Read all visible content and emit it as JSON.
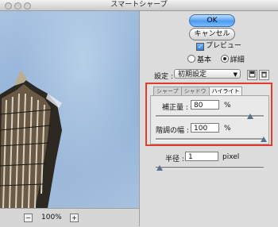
{
  "window": {
    "title": "スマートシャープ"
  },
  "preview": {
    "zoom": "100%",
    "zoom_out": "−",
    "zoom_in": "+"
  },
  "buttons": {
    "ok": "OK",
    "cancel": "キャンセル"
  },
  "preview_checkbox": {
    "label": "プレビュー",
    "checked": true
  },
  "mode": {
    "basic": "基本",
    "advanced": "詳細",
    "selected": "詳細"
  },
  "settings": {
    "label": "設定 :",
    "value": "初期設定"
  },
  "tabs": [
    {
      "label": "シャープ",
      "active": false
    },
    {
      "label": "シャドウ",
      "active": false
    },
    {
      "label": "ハイライト",
      "active": true
    }
  ],
  "highlight": {
    "fade_label": "補正量 :",
    "fade_value": "80",
    "fade_unit": "%",
    "fade_level": 0.8,
    "tonal_label": "階調の幅 :",
    "tonal_value": "100",
    "tonal_unit": "%",
    "tonal_level": 1.0
  },
  "radius": {
    "label": "半径 :",
    "value": "1",
    "unit": "pixel",
    "level": 0.01
  },
  "icons": {
    "save": "save-icon",
    "delete": "trash-icon",
    "select_arrow": "chevron-down-icon"
  }
}
